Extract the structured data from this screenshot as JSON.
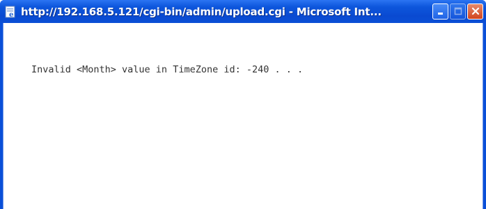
{
  "window": {
    "title": "http://192.168.5.121/cgi-bin/admin/upload.cgi - Microsoft Int...",
    "icon": "ie-page-icon",
    "controls": [
      "minimize-icon",
      "maximize-icon",
      "close-icon"
    ]
  },
  "content": {
    "message": "Invalid <Month> value in TimeZone id: -240 . . ."
  },
  "colors": {
    "titlebar": "#0a4fd8",
    "close_button": "#d2451f",
    "text": "#333333"
  }
}
